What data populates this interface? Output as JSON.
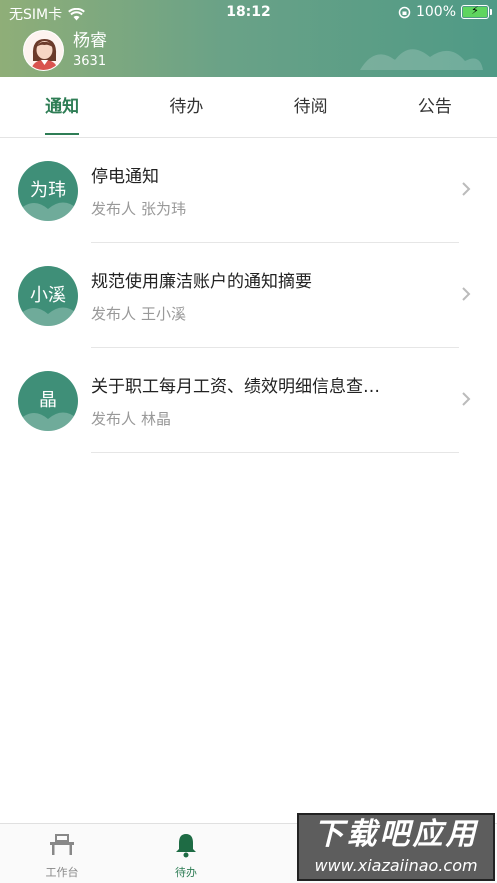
{
  "status_bar": {
    "carrier": "无SIM卡",
    "time": "18:12",
    "battery": "100%",
    "icons": [
      "wifi-icon",
      "orientation-lock-icon",
      "battery-charging-icon"
    ]
  },
  "user": {
    "name": "杨睿",
    "id": "3631"
  },
  "tabs": [
    {
      "label": "通知",
      "active": true
    },
    {
      "label": "待办",
      "active": false
    },
    {
      "label": "待阅",
      "active": false
    },
    {
      "label": "公告",
      "active": false
    }
  ],
  "notices": [
    {
      "avatar_text": "为玮",
      "title": "停电通知",
      "publisher_label": "发布人",
      "publisher": "张为玮"
    },
    {
      "avatar_text": "小溪",
      "title": "规范使用廉洁账户的通知摘要",
      "publisher_label": "发布人",
      "publisher": "王小溪"
    },
    {
      "avatar_text": "晶",
      "title": "关于职工每月工资、绩效明细信息查…",
      "publisher_label": "发布人",
      "publisher": "林晶"
    }
  ],
  "tabbar": [
    {
      "label": "工作台",
      "icon": "workbench-icon",
      "active": false
    },
    {
      "label": "待办",
      "icon": "bell-icon",
      "active": true
    }
  ],
  "watermark": {
    "title": "下载吧应用",
    "url": "www.xiazaiinao.com"
  },
  "colors": {
    "accent": "#2e7d55",
    "avatar_bg": "#3f8f78",
    "header_start": "#8fae78",
    "header_end": "#4f9a86"
  }
}
